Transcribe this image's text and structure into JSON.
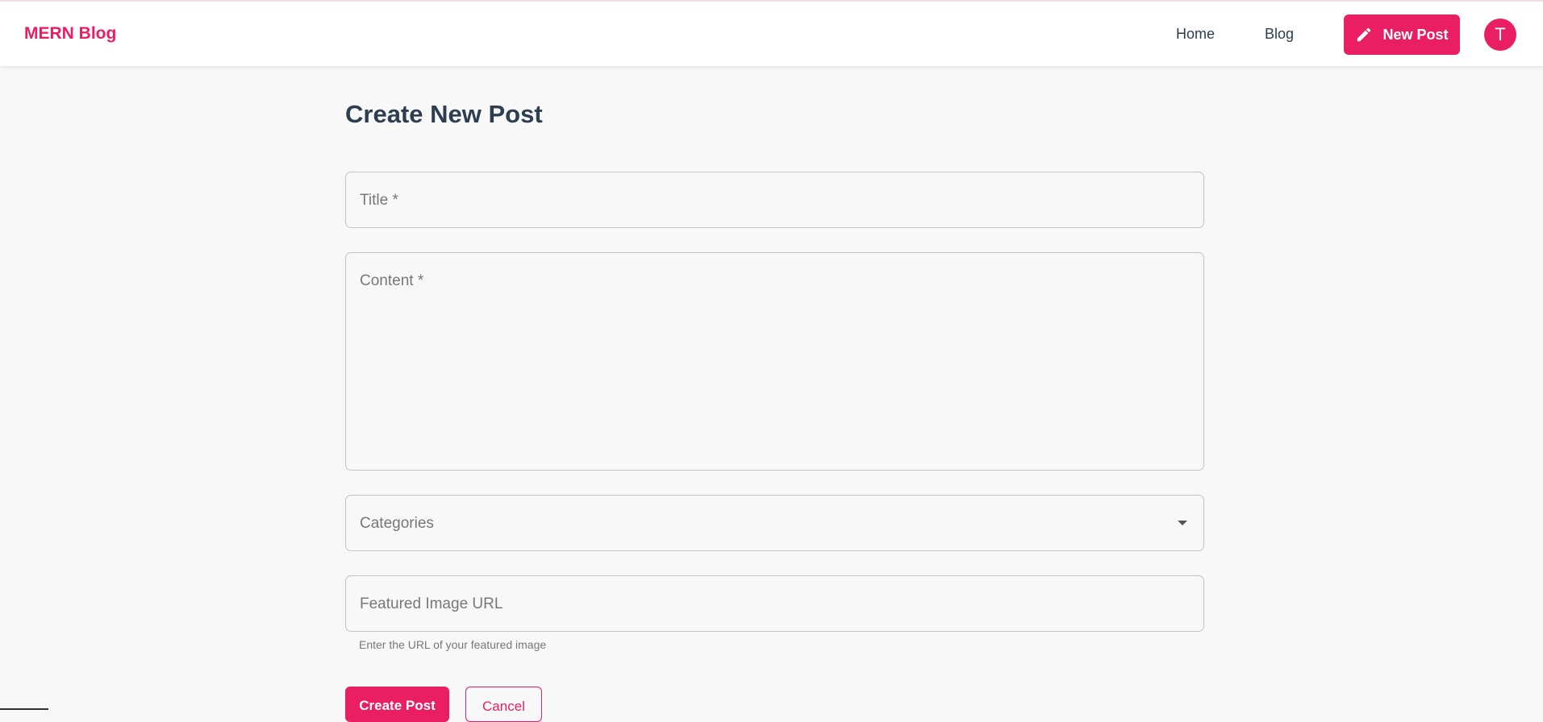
{
  "header": {
    "brand": "MERN Blog",
    "nav": {
      "home": "Home",
      "blog": "Blog"
    },
    "new_post_label": "New Post",
    "avatar_initial": "T"
  },
  "main": {
    "title": "Create New Post",
    "fields": {
      "title_placeholder": "Title *",
      "content_placeholder": "Content *",
      "categories_placeholder": "Categories",
      "image_placeholder": "Featured Image URL",
      "image_helper": "Enter the URL of your featured image"
    },
    "actions": {
      "create_label": "Create Post",
      "cancel_label": "Cancel"
    }
  },
  "colors": {
    "accent": "#e91e63",
    "background": "#f8f8f8",
    "text": "#2c3e50"
  }
}
